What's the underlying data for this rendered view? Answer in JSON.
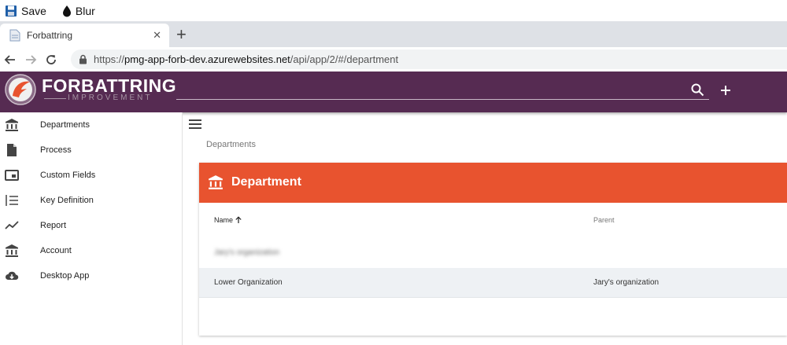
{
  "toolbar": {
    "save_label": "Save",
    "blur_label": "Blur"
  },
  "browser": {
    "tab_title": "Forbattring",
    "url_prefix": "https://",
    "url_host": "pmg-app-forb-dev.azurewebsites.net",
    "url_path": "/api/app/2/#/department"
  },
  "app": {
    "brand": "FORBATTRING",
    "brand_sub": "IMPROVEMENT",
    "colors": {
      "header": "#562b52",
      "accent": "#e8532f"
    }
  },
  "sidebar": {
    "items": [
      {
        "label": "Departments",
        "icon": "bank-icon"
      },
      {
        "label": "Process",
        "icon": "document-icon"
      },
      {
        "label": "Custom Fields",
        "icon": "custom-field-icon"
      },
      {
        "label": "Key Definition",
        "icon": "ordered-list-icon"
      },
      {
        "label": "Report",
        "icon": "trend-icon"
      },
      {
        "label": "Account",
        "icon": "bank-icon"
      },
      {
        "label": "Desktop App",
        "icon": "cloud-download-icon"
      }
    ]
  },
  "main": {
    "breadcrumb": "Departments",
    "card_title": "Department",
    "table": {
      "columns": [
        "Name",
        "Parent"
      ],
      "rows": [
        {
          "name": "Jary's organization",
          "parent": ""
        },
        {
          "name": "Lower Organization",
          "parent": "Jary's organization"
        }
      ]
    }
  }
}
